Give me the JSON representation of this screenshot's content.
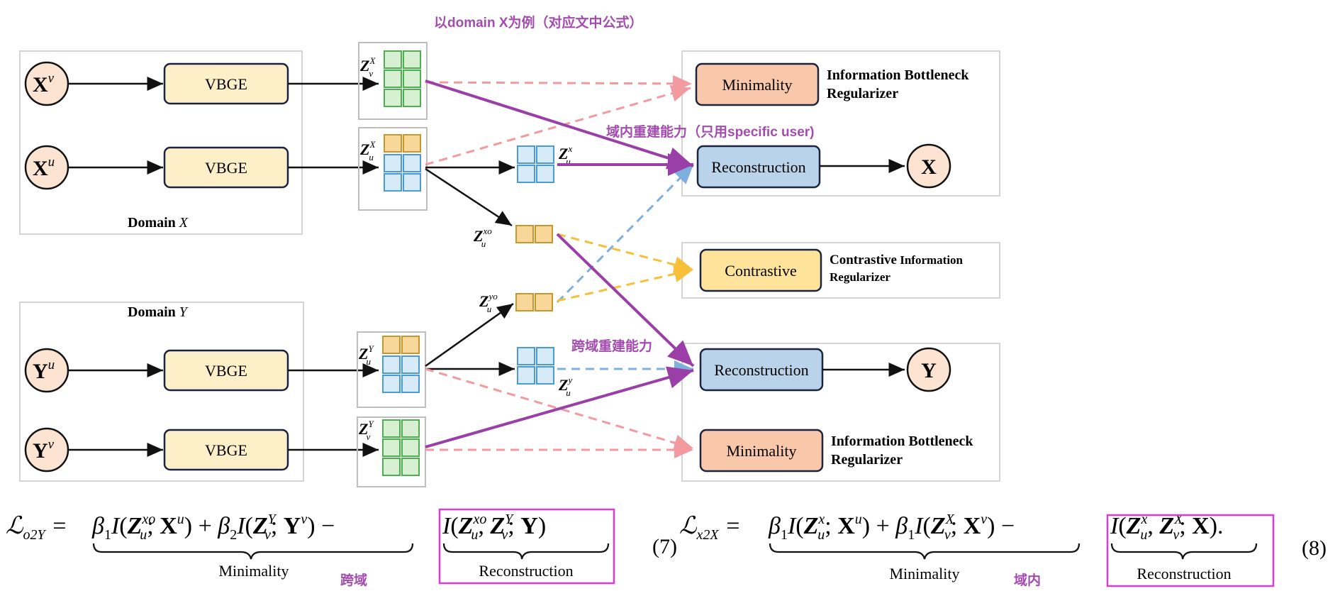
{
  "annotations": {
    "top_note": "以domain X为例（对应文中公式）",
    "intra_note": "域内重建能力（只用specific user)",
    "cross_note": "跨域重建能力",
    "eq7_tag": "跨域",
    "eq8_tag": "域内"
  },
  "domains": {
    "x_label": "Domain ",
    "x_var": "X",
    "y_label": "Domain ",
    "y_var": "Y"
  },
  "inputs": {
    "xv": {
      "base": "X",
      "sup": "v"
    },
    "xu": {
      "base": "X",
      "sup": "u"
    },
    "yu": {
      "base": "Y",
      "sup": "u"
    },
    "yv": {
      "base": "Y",
      "sup": "v"
    }
  },
  "encoders": {
    "label": "VBGE"
  },
  "latents": {
    "zvX": {
      "base": "Z",
      "sub": "v",
      "sup": "X"
    },
    "zuX": {
      "base": "Z",
      "sub": "u",
      "sup": "X"
    },
    "zuY": {
      "base": "Z",
      "sub": "u",
      "sup": "Y"
    },
    "zvY": {
      "base": "Z",
      "sub": "v",
      "sup": "Y"
    },
    "zux": {
      "base": "Z",
      "sub": "u",
      "sup": "x"
    },
    "zuxo": {
      "base": "Z",
      "sub": "u",
      "sup": "xo"
    },
    "zuyo": {
      "base": "Z",
      "sub": "u",
      "sup": "yo"
    },
    "zuy": {
      "base": "Z",
      "sub": "u",
      "sup": "y"
    }
  },
  "modules": {
    "minimality": "Minimality",
    "reconstruction": "Reconstruction",
    "contrastive": "Contrastive",
    "ib_line1": "Information Bottleneck",
    "ib_line2": "Regularizer",
    "ci_line1a": "Contrastive",
    "ci_line1b": " Information",
    "ci_line2": "Regularizer"
  },
  "outputs": {
    "x": "X",
    "y": "Y"
  },
  "equations": {
    "eq7_number": "(7)",
    "eq8_number": "(8)",
    "underbrace_min": "Minimality",
    "underbrace_rec": "Reconstruction"
  },
  "colors": {
    "input_fill": "#fde3d2",
    "vbge_fill": "#fdefc8",
    "reconstruction_fill": "#b9d3ea",
    "minimality_fill": "#f9c7a9",
    "contrastive_fill": "#fde49a",
    "green": "#4caf50",
    "blue": "#4a9ad6",
    "gold": "#c8962b",
    "purple": "#9b3fa8",
    "pink_dash": "#f29aa0",
    "blue_dash": "#7fb0dd",
    "yellow_dash": "#f7bf3a",
    "magenta_box": "#e03ad6"
  }
}
